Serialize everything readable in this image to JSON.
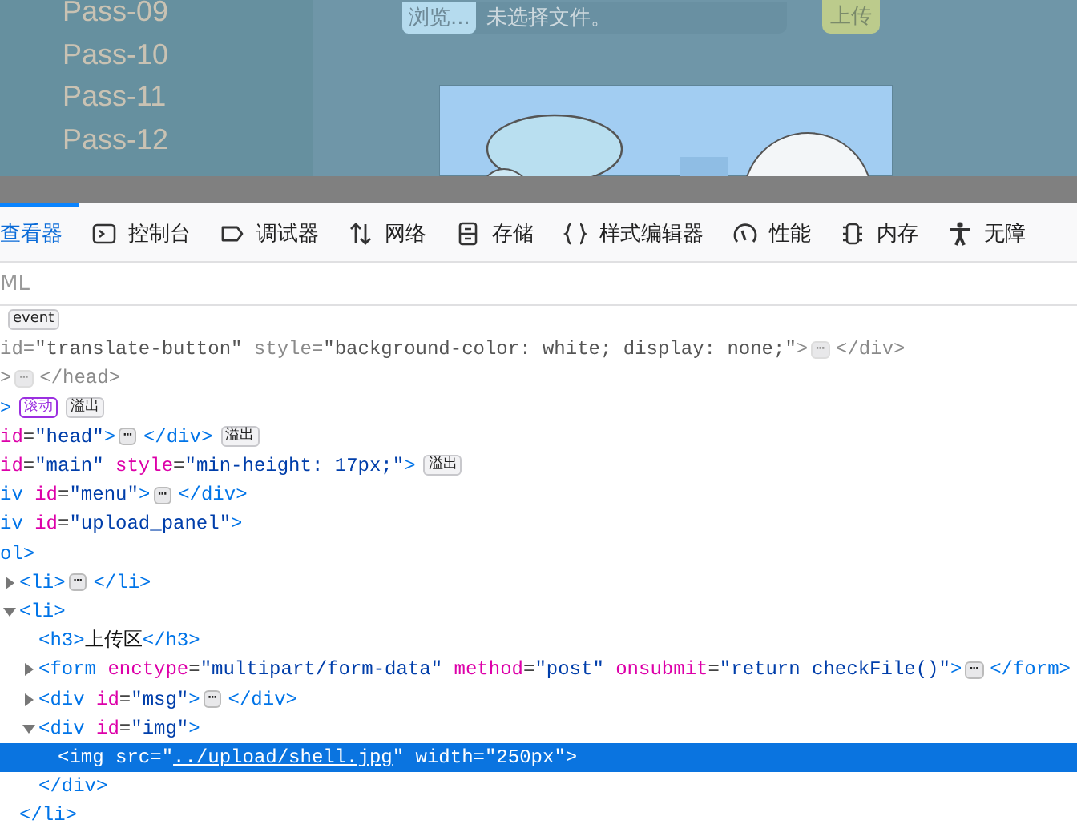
{
  "page": {
    "sidebar": {
      "items": [
        "Pass-09",
        "Pass-10",
        "Pass-11",
        "Pass-12"
      ]
    },
    "upload_form": {
      "browse_button": "浏览...",
      "file_status": "未选择文件。",
      "upload_button": "上传"
    }
  },
  "devtools": {
    "tabs": [
      {
        "label": "查看器",
        "selected": true
      },
      {
        "label": "控制台",
        "selected": false
      },
      {
        "label": "调试器",
        "selected": false
      },
      {
        "label": "网络",
        "selected": false
      },
      {
        "label": "存储",
        "selected": false
      },
      {
        "label": "样式编辑器",
        "selected": false
      },
      {
        "label": "性能",
        "selected": false
      },
      {
        "label": "内存",
        "selected": false
      },
      {
        "label": "无障",
        "selected": false
      }
    ],
    "search": {
      "placeholder": "ML"
    },
    "tree": [
      {
        "faded": false,
        "tokens": [
          {
            "kind": "badge",
            "text": "event"
          }
        ]
      },
      {
        "faded": true,
        "tokens": [
          {
            "kind": "attr",
            "text": "id"
          },
          {
            "kind": "punct",
            "text": "="
          },
          {
            "kind": "value",
            "text": "\"translate-button\""
          },
          {
            "kind": "attr",
            "text": " style"
          },
          {
            "kind": "punct",
            "text": "="
          },
          {
            "kind": "value",
            "text": "\"background-color: white; display: none;\""
          },
          {
            "kind": "tag",
            "text": ">"
          },
          {
            "kind": "more",
            "text": "⋯"
          },
          {
            "kind": "tag",
            "text": "</div>"
          }
        ]
      },
      {
        "faded": true,
        "tokens": [
          {
            "kind": "tag",
            "text": ">"
          },
          {
            "kind": "more",
            "text": "⋯"
          },
          {
            "kind": "tag",
            "text": "</head>"
          }
        ]
      },
      {
        "faded": false,
        "tokens": [
          {
            "kind": "tag",
            "text": ">"
          },
          {
            "kind": "scroll",
            "text": "滚动"
          },
          {
            "kind": "badge",
            "text": "溢出"
          }
        ]
      },
      {
        "faded": false,
        "tokens": [
          {
            "kind": "attr",
            "text": "id"
          },
          {
            "kind": "punct",
            "text": "="
          },
          {
            "kind": "value",
            "text": "\"head\""
          },
          {
            "kind": "tag",
            "text": ">"
          },
          {
            "kind": "more",
            "text": "⋯"
          },
          {
            "kind": "tag",
            "text": "</div>"
          },
          {
            "kind": "badge",
            "text": "溢出"
          }
        ]
      },
      {
        "faded": false,
        "tokens": [
          {
            "kind": "attr",
            "text": "id"
          },
          {
            "kind": "punct",
            "text": "="
          },
          {
            "kind": "value",
            "text": "\"main\""
          },
          {
            "kind": "attr",
            "text": " style"
          },
          {
            "kind": "punct",
            "text": "="
          },
          {
            "kind": "value",
            "text": "\"min-height: 17px;\""
          },
          {
            "kind": "tag",
            "text": ">"
          },
          {
            "kind": "badge",
            "text": "溢出"
          }
        ]
      },
      {
        "faded": false,
        "tokens": [
          {
            "kind": "tag",
            "text": "iv"
          },
          {
            "kind": "attr",
            "text": " id"
          },
          {
            "kind": "punct",
            "text": "="
          },
          {
            "kind": "value",
            "text": "\"menu\""
          },
          {
            "kind": "tag",
            "text": ">"
          },
          {
            "kind": "more",
            "text": "⋯"
          },
          {
            "kind": "tag",
            "text": "</div>"
          }
        ]
      },
      {
        "faded": false,
        "tokens": [
          {
            "kind": "tag",
            "text": "iv"
          },
          {
            "kind": "attr",
            "text": " id"
          },
          {
            "kind": "punct",
            "text": "="
          },
          {
            "kind": "value",
            "text": "\"upload_panel\""
          },
          {
            "kind": "tag",
            "text": ">"
          }
        ]
      },
      {
        "faded": false,
        "tokens": [
          {
            "kind": "tag",
            "text": "ol>"
          }
        ],
        "children": [
          {
            "expanded": false,
            "tokens": [
              {
                "kind": "tag",
                "text": "<li>"
              },
              {
                "kind": "more",
                "text": "⋯"
              },
              {
                "kind": "tag",
                "text": "</li>"
              }
            ]
          },
          {
            "expanded": true,
            "tokens": [
              {
                "kind": "tag",
                "text": "<li>"
              }
            ],
            "children": [
              {
                "tokens": [
                  {
                    "kind": "tag",
                    "text": "<h3>"
                  },
                  {
                    "kind": "text",
                    "text": "上传区"
                  },
                  {
                    "kind": "tag",
                    "text": "</h3>"
                  }
                ]
              },
              {
                "expanded": false,
                "tokens": [
                  {
                    "kind": "tag",
                    "text": "<form"
                  },
                  {
                    "kind": "attr",
                    "text": " enctype"
                  },
                  {
                    "kind": "punct",
                    "text": "="
                  },
                  {
                    "kind": "value",
                    "text": "\"multipart/form-data\""
                  },
                  {
                    "kind": "attr",
                    "text": " method"
                  },
                  {
                    "kind": "punct",
                    "text": "="
                  },
                  {
                    "kind": "value",
                    "text": "\"post\""
                  },
                  {
                    "kind": "attr",
                    "text": " onsubmit"
                  },
                  {
                    "kind": "punct",
                    "text": "="
                  },
                  {
                    "kind": "value",
                    "text": "\"return checkFile()\""
                  },
                  {
                    "kind": "tag",
                    "text": ">"
                  },
                  {
                    "kind": "more",
                    "text": "⋯"
                  },
                  {
                    "kind": "tag",
                    "text": "</form>"
                  }
                ]
              },
              {
                "expanded": false,
                "tokens": [
                  {
                    "kind": "tag",
                    "text": "<div"
                  },
                  {
                    "kind": "attr",
                    "text": " id"
                  },
                  {
                    "kind": "punct",
                    "text": "="
                  },
                  {
                    "kind": "value",
                    "text": "\"msg\""
                  },
                  {
                    "kind": "tag",
                    "text": ">"
                  },
                  {
                    "kind": "more",
                    "text": "⋯"
                  },
                  {
                    "kind": "tag",
                    "text": "</div>"
                  }
                ]
              },
              {
                "expanded": true,
                "tokens": [
                  {
                    "kind": "tag",
                    "text": "<div"
                  },
                  {
                    "kind": "attr",
                    "text": " id"
                  },
                  {
                    "kind": "punct",
                    "text": "="
                  },
                  {
                    "kind": "value",
                    "text": "\"img\""
                  },
                  {
                    "kind": "tag",
                    "text": ">"
                  }
                ],
                "children": [
                  {
                    "selected": true,
                    "tokens": [
                      {
                        "kind": "tag",
                        "text": "<img"
                      },
                      {
                        "kind": "attr",
                        "text": " src"
                      },
                      {
                        "kind": "punct",
                        "text": "=\""
                      },
                      {
                        "kind": "link",
                        "text": "../upload/shell.jpg"
                      },
                      {
                        "kind": "punct",
                        "text": "\""
                      },
                      {
                        "kind": "attr",
                        "text": " width"
                      },
                      {
                        "kind": "punct",
                        "text": "="
                      },
                      {
                        "kind": "value",
                        "text": "\"250px\""
                      },
                      {
                        "kind": "tag",
                        "text": ">"
                      }
                    ]
                  }
                ],
                "closing": "</div>"
              }
            ],
            "closing": "</li>"
          }
        ]
      }
    ]
  }
}
